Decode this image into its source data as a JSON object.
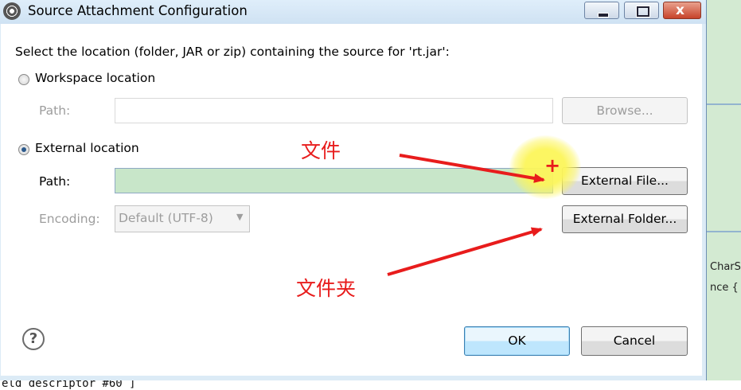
{
  "window": {
    "title": "Source Attachment Configuration",
    "minimize_label": "–",
    "maximize_label": "□",
    "close_label": "x"
  },
  "prompt": "Select the location (folder, JAR or zip) containing the source for 'rt.jar':",
  "workspace": {
    "radio_label": "Workspace location",
    "path_label": "Path:",
    "path_value": "",
    "browse_button": "Browse..."
  },
  "external": {
    "radio_label": "External location",
    "path_label": "Path:",
    "path_value": "",
    "encoding_label": "Encoding:",
    "encoding_value": "Default (UTF-8)",
    "file_button": "External File...",
    "folder_button": "External Folder..."
  },
  "annotations": {
    "file_label": "文件",
    "folder_label": "文件夹",
    "color": "#e81c1c"
  },
  "footer": {
    "help_label": "?",
    "ok_button": "OK",
    "cancel_button": "Cancel"
  },
  "background": {
    "right_fragment_1": "CharS",
    "right_fragment_2": "nce {",
    "bottom_fragment": "eld descriptor #60 ]"
  },
  "colors": {
    "path_field_highlight": "#c8e6c9",
    "dialog_frame": "#dcebf6",
    "ide_background": "#d3ead2"
  }
}
